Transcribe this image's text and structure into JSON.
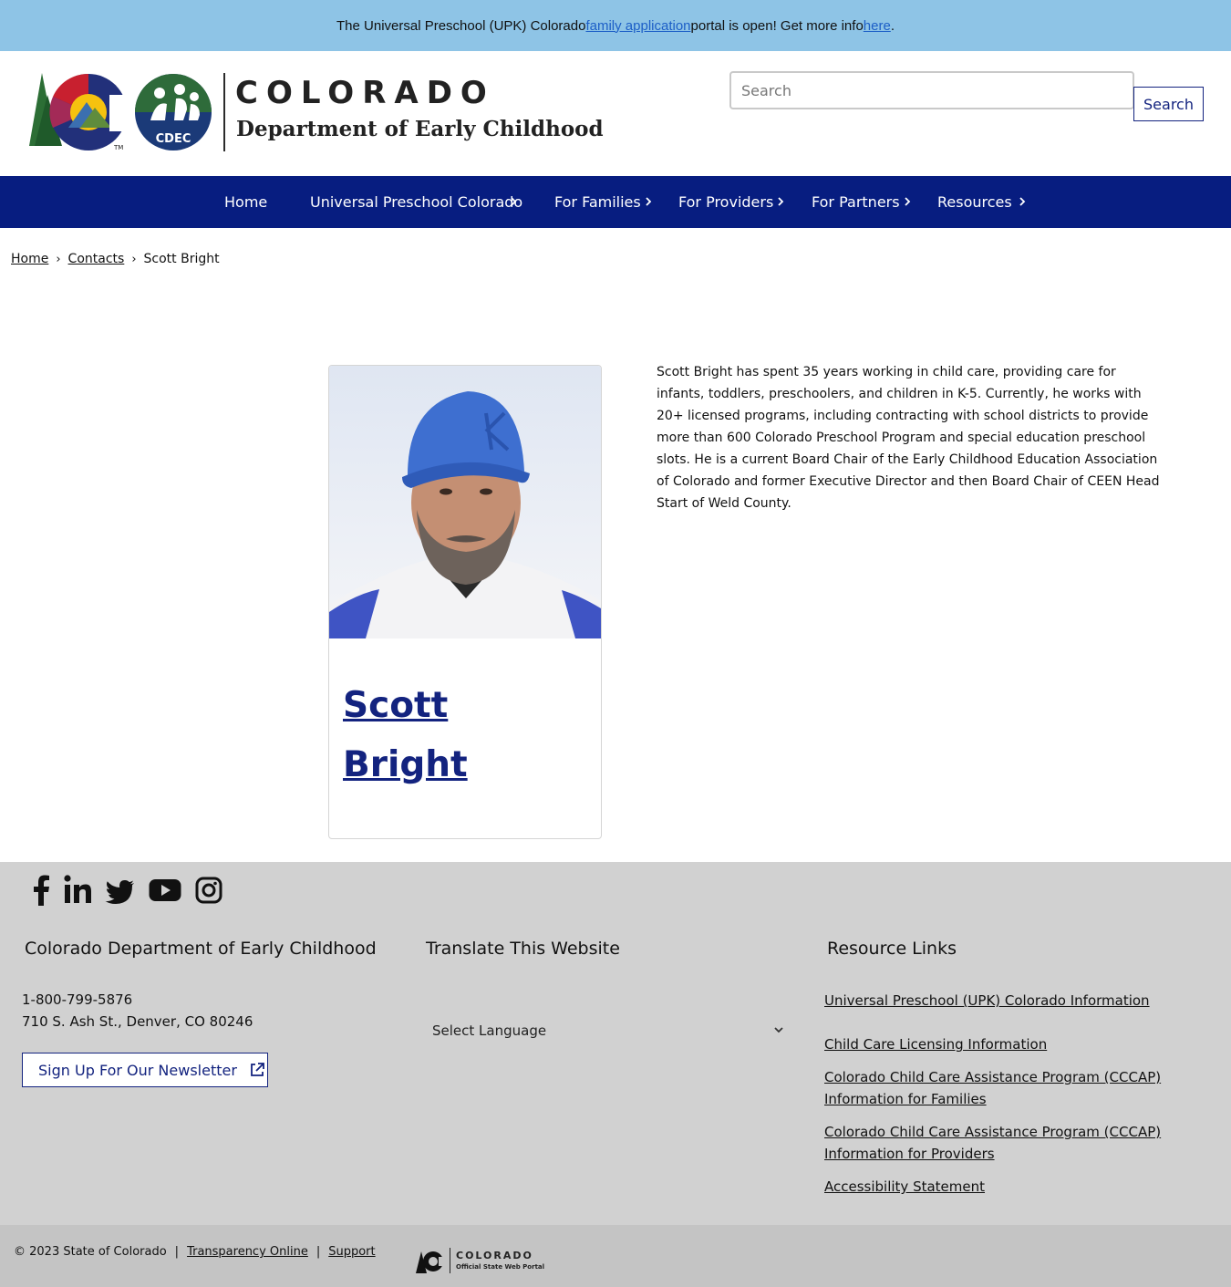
{
  "alert": {
    "text_before": "The Universal Preschool (UPK) Colorado ",
    "link1": "family application",
    "text_middle": " portal is open! Get more info ",
    "link2": "here",
    "text_after": "."
  },
  "header": {
    "brand_state": "COLORADO",
    "brand_department": "Department of Early Childhood",
    "cdec_badge": "CDEC",
    "search_placeholder": "Search",
    "search_button": "Search"
  },
  "nav": {
    "items": [
      {
        "label": "Home",
        "has_chevron": false
      },
      {
        "label": "Universal Preschool Colorado",
        "has_chevron": true
      },
      {
        "label": "For Families",
        "has_chevron": true
      },
      {
        "label": "For Providers",
        "has_chevron": true
      },
      {
        "label": "For Partners",
        "has_chevron": true
      },
      {
        "label": "Resources",
        "has_chevron": true
      }
    ]
  },
  "breadcrumb": {
    "home": "Home",
    "contacts": "Contacts",
    "current": "Scott Bright"
  },
  "profile": {
    "name_first": "Scott",
    "name_last": "Bright",
    "bio": "Scott Bright has spent 35 years working in child care, providing care for infants, toddlers, preschoolers, and children in K-5. Currently, he works with 20+ licensed programs, including contracting with school districts to provide more than 600 Colorado Preschool Program and special education preschool slots. He is a current Board Chair of the Early Childhood Education Association of Colorado and former Executive Director and then Board Chair of CEEN Head Start of Weld County."
  },
  "footer": {
    "social_icons": [
      "facebook-icon",
      "linkedin-icon",
      "twitter-icon",
      "youtube-icon",
      "instagram-icon"
    ],
    "org_heading": "Colorado Department of Early Childhood",
    "phone": "1-800-799-5876",
    "address": "710 S. Ash St., Denver, CO 80246",
    "newsletter_button": "Sign Up For Our Newsletter",
    "translate_heading": "Translate This Website",
    "language_select": "Select Language",
    "resources_heading": "Resource Links",
    "resource_links": [
      "Universal Preschool (UPK) Colorado Information",
      "Child Care Licensing Information",
      "Colorado Child Care Assistance Program (CCCAP) Information for Families",
      "Colorado Child Care Assistance Program (CCCAP) Information for Providers",
      "Accessibility Statement"
    ]
  },
  "bottom": {
    "copyright": "© 2023 State of Colorado",
    "transparency": "Transparency Online",
    "support": "Support",
    "portal_name": "COLORADO",
    "portal_sub": "Official State Web Portal"
  },
  "colors": {
    "alert_bg": "#8ec4e6",
    "nav_bg": "#071d80",
    "accent_navy": "#13237f",
    "footer_bg": "#d1d1d1",
    "bottom_bg": "#c4c4c4"
  }
}
